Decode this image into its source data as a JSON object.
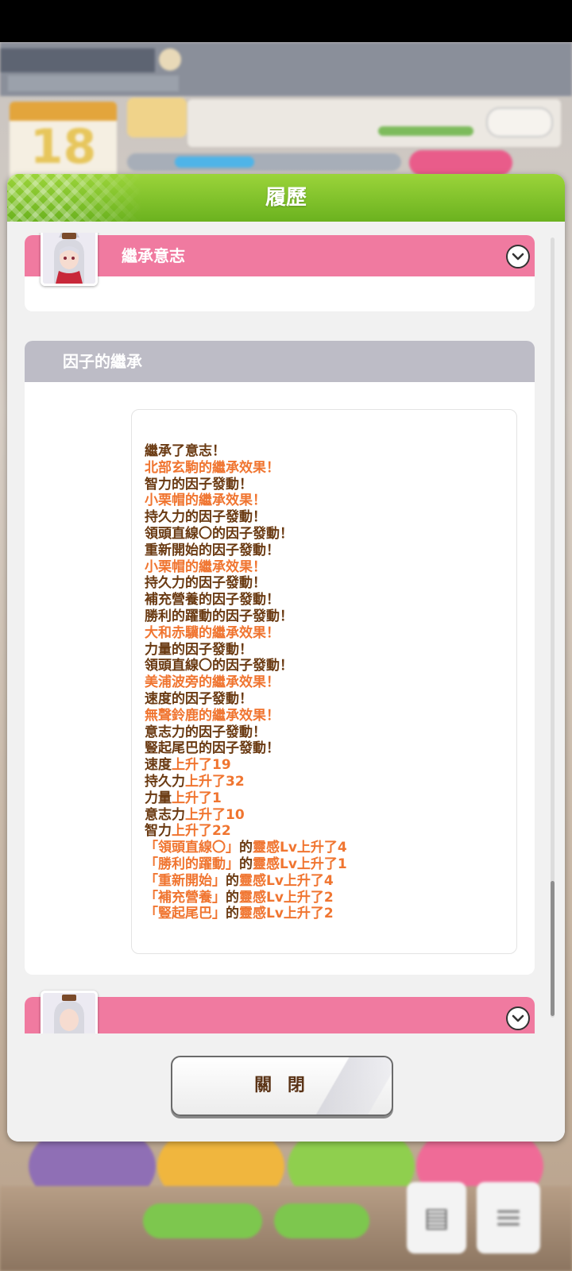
{
  "background": {
    "calendar_day": "18"
  },
  "modal": {
    "title": "履歷",
    "sections": {
      "inherit_will": {
        "title": "繼承意志"
      },
      "factor_inherit": {
        "title": "因子的繼承"
      }
    },
    "log_lines": [
      [
        {
          "t": "繼承了意志！",
          "c": "brown"
        }
      ],
      [
        {
          "t": "北部玄駒的繼承效果！",
          "c": "orange"
        }
      ],
      [
        {
          "t": "智力的因子發動！",
          "c": "brown"
        }
      ],
      [
        {
          "t": "小栗帽的繼承效果！",
          "c": "orange"
        }
      ],
      [
        {
          "t": "持久力的因子發動！",
          "c": "brown"
        }
      ],
      [
        {
          "t": "領頭直線〇的因子發動！",
          "c": "brown"
        }
      ],
      [
        {
          "t": "重新開始的因子發動！",
          "c": "brown"
        }
      ],
      [
        {
          "t": "小栗帽的繼承效果！",
          "c": "orange"
        }
      ],
      [
        {
          "t": "持久力的因子發動！",
          "c": "brown"
        }
      ],
      [
        {
          "t": "補充營養的因子發動！",
          "c": "brown"
        }
      ],
      [
        {
          "t": "勝利的躍動的因子發動！",
          "c": "brown"
        }
      ],
      [
        {
          "t": "大和赤驥的繼承效果！",
          "c": "orange"
        }
      ],
      [
        {
          "t": "力量的因子發動！",
          "c": "brown"
        }
      ],
      [
        {
          "t": "領頭直線〇的因子發動！",
          "c": "brown"
        }
      ],
      [
        {
          "t": "美浦波旁的繼承效果！",
          "c": "orange"
        }
      ],
      [
        {
          "t": "速度的因子發動！",
          "c": "brown"
        }
      ],
      [
        {
          "t": "無聲鈴鹿的繼承效果！",
          "c": "orange"
        }
      ],
      [
        {
          "t": "意志力的因子發動！",
          "c": "brown"
        }
      ],
      [
        {
          "t": "豎起尾巴的因子發動！",
          "c": "brown"
        }
      ],
      [
        {
          "t": "速度",
          "c": "brown"
        },
        {
          "t": "上升了19",
          "c": "orange"
        }
      ],
      [
        {
          "t": "持久力",
          "c": "brown"
        },
        {
          "t": "上升了32",
          "c": "orange"
        }
      ],
      [
        {
          "t": "力量",
          "c": "brown"
        },
        {
          "t": "上升了1",
          "c": "orange"
        }
      ],
      [
        {
          "t": "意志力",
          "c": "brown"
        },
        {
          "t": "上升了10",
          "c": "orange"
        }
      ],
      [
        {
          "t": "智力",
          "c": "brown"
        },
        {
          "t": "上升了22",
          "c": "orange"
        }
      ],
      [
        {
          "t": "「領頭直線〇」",
          "c": "orange"
        },
        {
          "t": "的",
          "c": "brown"
        },
        {
          "t": "靈感Lv上升了4",
          "c": "orange"
        }
      ],
      [
        {
          "t": "「勝利的躍動」",
          "c": "orange"
        },
        {
          "t": "的",
          "c": "brown"
        },
        {
          "t": "靈感Lv上升了1",
          "c": "orange"
        }
      ],
      [
        {
          "t": "「重新開始」",
          "c": "orange"
        },
        {
          "t": "的",
          "c": "brown"
        },
        {
          "t": "靈感Lv上升了4",
          "c": "orange"
        }
      ],
      [
        {
          "t": "「補充營養」",
          "c": "orange"
        },
        {
          "t": "的",
          "c": "brown"
        },
        {
          "t": "靈感Lv上升了2",
          "c": "orange"
        }
      ],
      [
        {
          "t": "「豎起尾巴」",
          "c": "orange"
        },
        {
          "t": "的",
          "c": "brown"
        },
        {
          "t": "靈感Lv上升了2",
          "c": "orange"
        }
      ]
    ],
    "close_button": "關 閉"
  },
  "colors": {
    "header_green": "#7cc22a",
    "section_pink": "#f07aa0",
    "section_gray": "#bdbcc6",
    "text_brown": "#6a3a12",
    "text_orange": "#f07530"
  },
  "icons": {
    "expand": "chevron-down-icon"
  }
}
